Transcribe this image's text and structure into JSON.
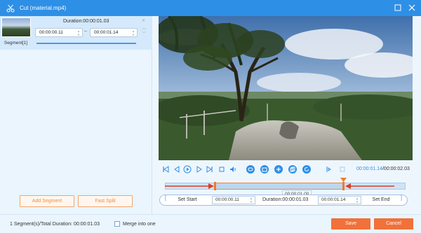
{
  "window": {
    "title": "Cut (material.mp4)",
    "accent_color": "#2e8fe6",
    "icons": [
      "scissors-icon",
      "restore-icon",
      "close-icon"
    ]
  },
  "segments": {
    "items": [
      {
        "label": "Segment[1]",
        "duration": "Duration:00:00:01.03",
        "start": "00:00:00.11",
        "dash": "–",
        "end": "00:00:01.14"
      }
    ],
    "add_button": "Add Segment",
    "fast_split_button": "Fast Split"
  },
  "player": {
    "current_time": "00:00:01.14",
    "total_time": "/00:00:02.03",
    "controls": [
      "skip-start-icon",
      "prev-frame-icon",
      "play-icon",
      "next-frame-icon",
      "skip-end-icon",
      "stop-icon",
      "volume-icon",
      "loop-icon",
      "snapshot-icon",
      "add-icon",
      "copy-icon",
      "reset-icon",
      "mark-in-icon",
      "mark-out-icon"
    ]
  },
  "timeline": {
    "tooltip": "00:00:01.00",
    "selection_start_fraction": 0.21,
    "selection_end_fraction": 0.74,
    "handle_color": "#f07a2a"
  },
  "setbar": {
    "set_start": "Set Start",
    "start_time": "00:00:00.11",
    "duration": "Duration:00:00:01.03",
    "end_time": "00:00:01.14",
    "set_end": "Set End"
  },
  "footer": {
    "summary": "1 Segment(s)/Total Duration: 00:00:01.03",
    "merge_label": "Merge into one",
    "merge_checked": false,
    "save": "Save",
    "cancel": "Cancel",
    "primary_color": "#f0713a"
  }
}
